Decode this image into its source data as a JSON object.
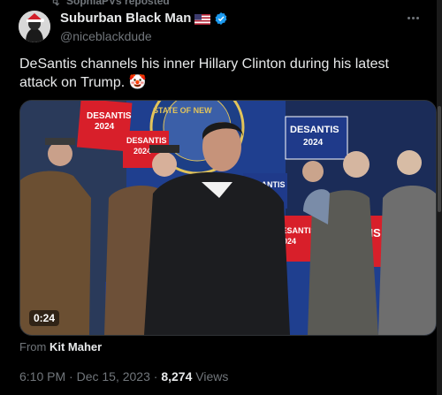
{
  "repost": {
    "text": "SophiaPVs reposted"
  },
  "author": {
    "name": "Suburban Black Man",
    "handle": "@niceblackdude",
    "flag_icon": "us-flag-icon",
    "verified_icon": "verified-badge-icon",
    "verified_color": "#1d9bf0"
  },
  "tweet": {
    "text": "DeSantis channels his inner Hillary Clinton during his latest attack on Trump. 🤡"
  },
  "media": {
    "timecode": "0:24",
    "sign_lines": [
      "DESANTIS",
      "2024"
    ],
    "seal_text": "STATE OF NEW",
    "sign_color": "#d81f2a",
    "sign_color_alt": "#1f3a8a"
  },
  "attribution": {
    "prefix": "From",
    "source": "Kit Maher"
  },
  "meta": {
    "time": "6:10 PM",
    "separator": "·",
    "date": "Dec 15, 2023",
    "views_count": "8,274",
    "views_label": "Views"
  }
}
